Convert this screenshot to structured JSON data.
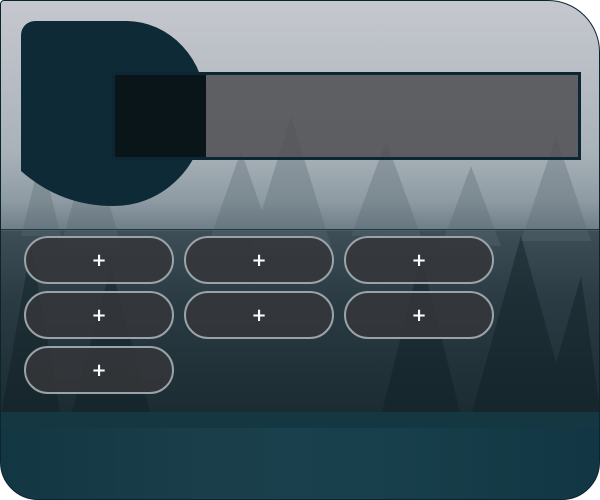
{
  "app": {
    "display_value": ""
  },
  "keypad": {
    "keys": [
      {
        "label": "+"
      },
      {
        "label": "+"
      },
      {
        "label": "+"
      },
      {
        "label": "+"
      },
      {
        "label": "+"
      },
      {
        "label": "+"
      },
      {
        "label": "+"
      }
    ]
  },
  "colors": {
    "frame": "#0b2530",
    "logo": "#0e2a36",
    "display_bg": "#4e4e50",
    "key_bg": "#343639",
    "key_border": "#9aa3a8",
    "footer": "#143741"
  }
}
